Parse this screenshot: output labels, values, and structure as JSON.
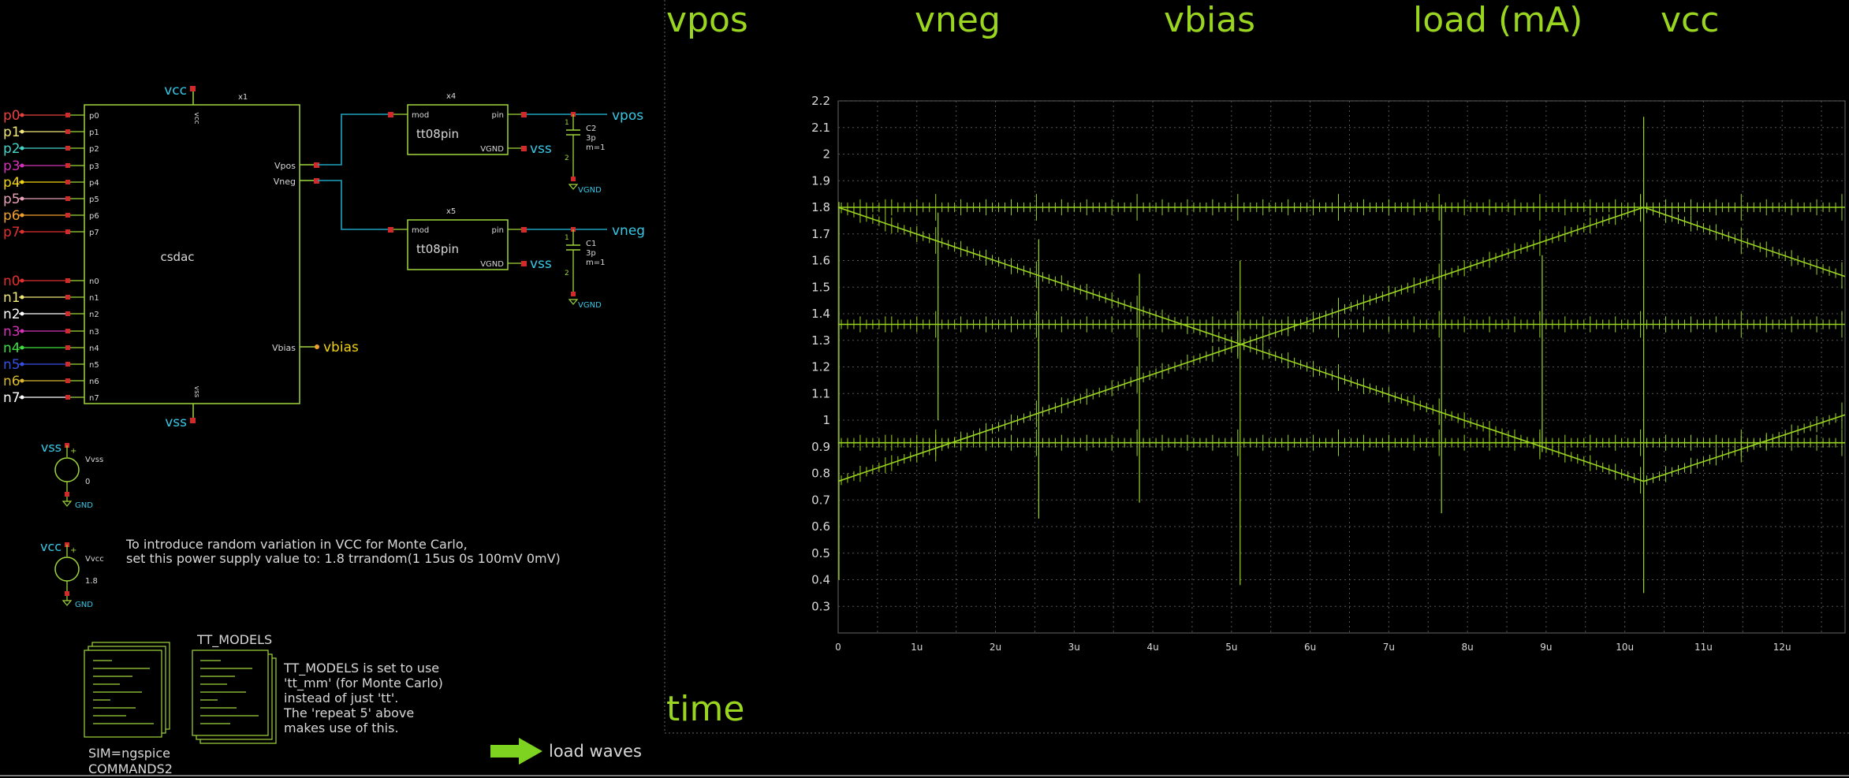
{
  "colors": {
    "background": "#000000",
    "wire": "#1fa2c0",
    "symbol": "#9fd63b",
    "pin_marker": "#d22a2a",
    "net_label": "#38c8e6",
    "vbias_label": "#f2d40f",
    "text": "#d8d8d8",
    "waveform": "#9ad61f",
    "grid": "#555555"
  },
  "schematic": {
    "csdac": {
      "name": "csdac",
      "instance": "x1",
      "vcc_pin": "vcc",
      "vss_pin": "vss",
      "vcc_net": "vcc",
      "vss_net": "vss",
      "left_pins": [
        "p0",
        "p1",
        "p2",
        "p3",
        "p4",
        "p5",
        "p6",
        "p7",
        "n0",
        "n1",
        "n2",
        "n3",
        "n4",
        "n5",
        "n6",
        "n7"
      ],
      "right_pins": {
        "vpos": "Vpos",
        "vneg": "Vneg",
        "vbias": "Vbias"
      },
      "vbias_net": "vbias"
    },
    "input_nets": [
      {
        "label": "p0",
        "color": "#e84141"
      },
      {
        "label": "p1",
        "color": "#f2e87a"
      },
      {
        "label": "p2",
        "color": "#45d4c8"
      },
      {
        "label": "p3",
        "color": "#d433b8"
      },
      {
        "label": "p4",
        "color": "#f2d40f"
      },
      {
        "label": "p5",
        "color": "#e8a0b8"
      },
      {
        "label": "p6",
        "color": "#f2a030"
      },
      {
        "label": "p7",
        "color": "#e23030"
      },
      {
        "label": "n0",
        "color": "#e23030"
      },
      {
        "label": "n1",
        "color": "#f2e87a"
      },
      {
        "label": "n2",
        "color": "#ffffff"
      },
      {
        "label": "n3",
        "color": "#d433b8"
      },
      {
        "label": "n4",
        "color": "#3ee03e"
      },
      {
        "label": "n5",
        "color": "#3850e0"
      },
      {
        "label": "n6",
        "color": "#d8b830"
      },
      {
        "label": "n7",
        "color": "#ffffff"
      }
    ],
    "pins": [
      {
        "instance": "x4",
        "name": "tt08pin",
        "mod": "mod",
        "pin": "pin",
        "vgnd": "VGND",
        "vss_net": "vss",
        "out_net": "vpos",
        "cap": {
          "name": "C2",
          "value": "3p",
          "m": "m=1",
          "p1": "1",
          "p2": "2",
          "gnd": "VGND"
        }
      },
      {
        "instance": "x5",
        "name": "tt08pin",
        "mod": "mod",
        "pin": "pin",
        "vgnd": "VGND",
        "vss_net": "vss",
        "out_net": "vneg",
        "cap": {
          "name": "C1",
          "value": "3p",
          "m": "m=1",
          "p1": "1",
          "p2": "2",
          "gnd": "VGND"
        }
      }
    ],
    "vss_source": {
      "net": "vss",
      "name": "Vvss",
      "value": "0",
      "gnd": "GND",
      "plus": "+"
    },
    "vcc_source": {
      "net": "vcc",
      "name": "Vvcc",
      "value": "1.8",
      "gnd": "GND",
      "plus": "+"
    },
    "note_lines": [
      "To introduce random variation in VCC for Monte Carlo,",
      "set this power supply value to: 1.8 trrandom(1 15us 0s 100mV 0mV)"
    ],
    "code_block": {
      "sim": "SIM=ngspice",
      "commands": "COMMANDS2"
    },
    "tt_models": {
      "title": "TT_MODELS",
      "lines": [
        "TT_MODELS is set to use",
        "'tt_mm' (for Monte Carlo)",
        "instead of just 'tt'.",
        "The 'repeat 5' above",
        "makes use of this."
      ]
    },
    "load_waves_label": "load waves"
  },
  "graph_header": {
    "signals": [
      "vpos",
      "vneg",
      "vbias",
      "load (mA)",
      "vcc"
    ],
    "xlabel": "time"
  },
  "chart_data": {
    "type": "line",
    "title": "",
    "xlabel": "time",
    "ylabel": "",
    "xlim": [
      0,
      12.8
    ],
    "ylim": [
      0.2,
      2.2
    ],
    "x_tick_values": [
      0,
      1,
      2,
      3,
      4,
      5,
      6,
      7,
      8,
      9,
      10,
      11,
      12
    ],
    "x_tick_labels": [
      "0",
      "1u",
      "2u",
      "3u",
      "4u",
      "5u",
      "6u",
      "7u",
      "8u",
      "9u",
      "10u",
      "11u",
      "12u"
    ],
    "y_tick_labels": [
      "0.3",
      "0.4",
      "0.5",
      "0.6",
      "0.7",
      "0.8",
      "0.9",
      "1",
      "1.1",
      "1.2",
      "1.3",
      "1.4",
      "1.5",
      "1.6",
      "1.7",
      "1.8",
      "1.9",
      "2",
      "2.1",
      "2.2"
    ],
    "y_tick_values": [
      0.3,
      0.4,
      0.5,
      0.6,
      0.7,
      0.8,
      0.9,
      1.0,
      1.1,
      1.2,
      1.3,
      1.4,
      1.5,
      1.6,
      1.7,
      1.8,
      1.9,
      2.0,
      2.1,
      2.2
    ],
    "grid": true,
    "series": [
      {
        "x": [
          0,
          10.24,
          12.8
        ],
        "y": [
          1.8,
          0.77,
          1.02
        ]
      },
      {
        "x": [
          0,
          10.24,
          12.8
        ],
        "y": [
          0.77,
          1.8,
          1.54
        ]
      },
      {
        "x": [
          0,
          12.8
        ],
        "y": [
          1.36,
          1.36
        ]
      },
      {
        "x": [
          0,
          12.8
        ],
        "y": [
          0.915,
          0.915
        ]
      },
      {
        "x": [
          0,
          12.8
        ],
        "y": [
          1.8,
          1.8
        ]
      }
    ],
    "spikes": [
      {
        "x": 1.27,
        "y0": 1.0,
        "y1": 1.78
      },
      {
        "x": 2.55,
        "y0": 0.63,
        "y1": 1.68
      },
      {
        "x": 3.83,
        "y0": 0.69,
        "y1": 1.55
      },
      {
        "x": 5.11,
        "y0": 0.38,
        "y1": 1.6
      },
      {
        "x": 7.67,
        "y0": 0.65,
        "y1": 1.81
      },
      {
        "x": 8.95,
        "y0": 0.88,
        "y1": 1.62
      },
      {
        "x": 10.24,
        "y0": 0.35,
        "y1": 2.14
      }
    ]
  }
}
